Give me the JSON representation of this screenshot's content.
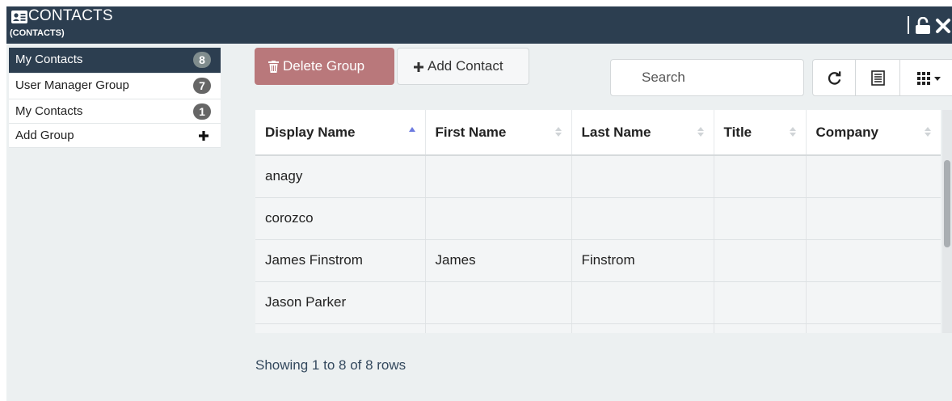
{
  "window": {
    "title": "CONTACTS",
    "subtitle": "(CONTACTS)",
    "icons": [
      "address-card-icon",
      "unlock-icon",
      "close-icon"
    ],
    "header_bg": "#2c3e50"
  },
  "sidebar": {
    "groups": [
      {
        "label": "My Contacts",
        "count": "8",
        "active": true
      },
      {
        "label": "User Manager Group",
        "count": "7"
      },
      {
        "label": "My Contacts",
        "count": "1"
      },
      {
        "label": "Add Group"
      }
    ]
  },
  "toolbar": {
    "delete_label": "Delete Group",
    "delete_icon": "trash-icon",
    "delete_color": "#b9787b",
    "add_label": "Add Contact",
    "add_icon": "plus-icon",
    "search_placeholder": "Search",
    "refresh_icon": "refresh-icon",
    "list_icon": "list-view-icon",
    "columns_icon": "grid-columns-icon"
  },
  "table": {
    "columns": [
      "Display Name",
      "First Name",
      "Last Name",
      "Title",
      "Company"
    ],
    "sorted_column": "Display Name",
    "sort_direction": "ascending",
    "rows": [
      [
        "anagy",
        "",
        "",
        "",
        ""
      ],
      [
        "corozco",
        "",
        "",
        "",
        ""
      ],
      [
        "James Finstrom",
        "James",
        "Finstrom",
        "",
        ""
      ],
      [
        "Jason Parker",
        "",
        "",
        "",
        ""
      ]
    ]
  },
  "footer": {
    "summary": "Showing 1 to 8 of 8 rows"
  }
}
